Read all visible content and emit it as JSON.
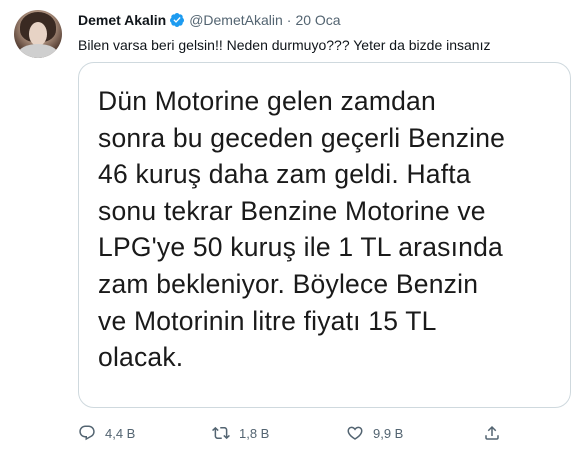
{
  "tweet": {
    "author_name": "Demet Akalin",
    "handle": "@DemetAkalin",
    "separator": "·",
    "date": "20 Oca",
    "text": "Bilen varsa beri gelsin!! Neden durmuyo??? Yeter da bizde insanız",
    "image_text_lines": [
      "Dün Motorine gelen zamdan",
      "sonra bu geceden geçerli Benzine",
      "46 kuruş daha zam geldi. Hafta",
      "sonu tekrar Benzine Motorine ve",
      "LPG'ye 50 kuruş ile 1 TL arasında",
      "zam bekleniyor. Böylece Benzin",
      "ve Motorinin litre fiyatı 15 TL",
      "olacak."
    ]
  },
  "actions": {
    "reply_count": "4,4 B",
    "retweet_count": "1,8 B",
    "like_count": "9,9 B"
  },
  "icons": {
    "verified": "verified-badge-icon",
    "reply": "reply-icon",
    "retweet": "retweet-icon",
    "like": "heart-icon",
    "share": "share-icon"
  },
  "colors": {
    "verified_blue": "#1d9bf0",
    "secondary_text": "#536471",
    "border": "#cfd9de"
  }
}
